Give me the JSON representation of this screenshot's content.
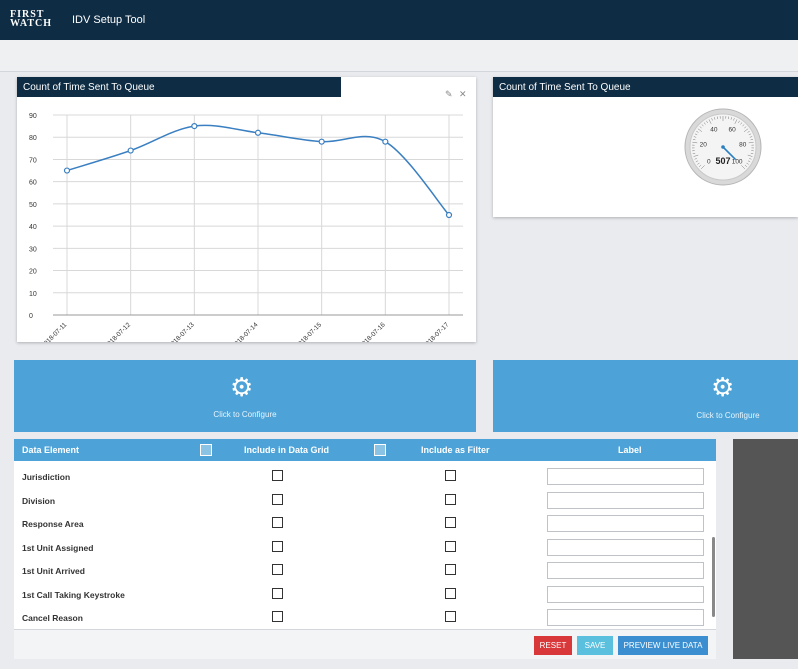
{
  "app": {
    "logo_line1": "FIRST",
    "logo_line2": "WATCH",
    "title": "IDV Setup Tool"
  },
  "chart_card": {
    "title": "Count of Time Sent To Queue",
    "edit_icon": "pencil-icon",
    "close_icon": "close-icon"
  },
  "gauge_card": {
    "title": "Count of Time Sent To Queue",
    "value": "507",
    "ticks": [
      "0",
      "20",
      "40",
      "60",
      "80",
      "100"
    ],
    "needle_value": 100
  },
  "chart_data": {
    "type": "line",
    "x": [
      "2018-07-11",
      "2018-07-12",
      "2018-07-13",
      "2018-07-14",
      "2018-07-15",
      "2018-07-16",
      "2018-07-17"
    ],
    "series": [
      {
        "values": [
          65,
          74,
          85,
          82,
          78,
          78,
          45
        ]
      }
    ],
    "ylim": [
      0,
      90
    ],
    "yticks": [
      "0",
      "10",
      "20",
      "30",
      "40",
      "50",
      "60",
      "70",
      "80",
      "90"
    ],
    "grid": true,
    "color": "#3a7fc1"
  },
  "configure": {
    "left_label": "Click to Configure",
    "right_label": "Click to Configure",
    "icon": "gear-icon"
  },
  "grid": {
    "headers": {
      "data_element": "Data Element",
      "include_grid": "Include in Data Grid",
      "include_filter": "Include as Filter",
      "label": "Label"
    },
    "rows": [
      {
        "name": "Jurisdiction"
      },
      {
        "name": "Division"
      },
      {
        "name": "Response Area"
      },
      {
        "name": "1st Unit Assigned"
      },
      {
        "name": "1st Unit Arrived"
      },
      {
        "name": "1st Call Taking Keystroke"
      },
      {
        "name": "Cancel Reason"
      }
    ]
  },
  "buttons": {
    "reset": "RESET",
    "save": "SAVE",
    "preview": "PREVIEW LIVE DATA"
  },
  "colors": {
    "topbar": "#0e2c44",
    "accent": "#4da3d8",
    "reset": "#d9383a",
    "save": "#5bc0de",
    "preview": "#3b8fd1"
  }
}
